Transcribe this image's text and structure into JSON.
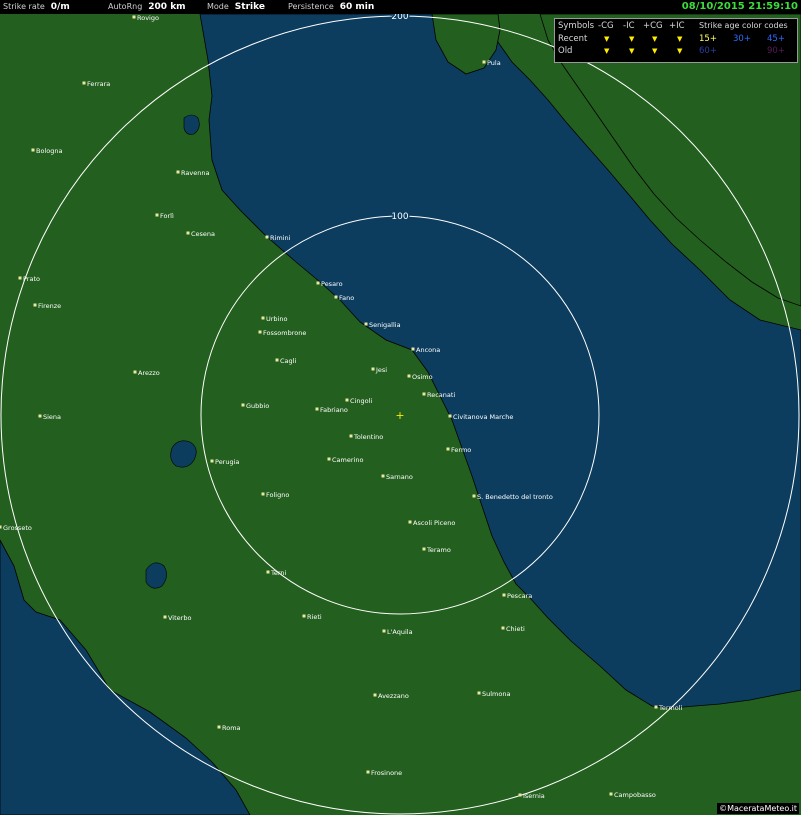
{
  "topbar": {
    "strike_rate_label": "Strike rate",
    "strike_rate_value": "0/m",
    "autorng_label": "AutoRng",
    "autorng_value": "200 km",
    "mode_label": "Mode",
    "mode_value": "Strike",
    "persistence_label": "Persistence",
    "persistence_value": "60 min",
    "datetime": "08/10/2015 21:59:10"
  },
  "legend": {
    "symbols_label": "Symbols",
    "col_cg_neg": "-CG",
    "col_ic_neg": "-IC",
    "col_cg_pos": "+CG",
    "col_ic_pos": "+IC",
    "age_title": "Strike age color codes",
    "recent_label": "Recent",
    "old_label": "Old",
    "symbol_glyph": "▼",
    "age_codes": [
      "15+",
      "30+",
      "45+",
      "60+",
      "90+"
    ],
    "age_colors": [
      "#ffff66",
      "#2a6cff",
      "#2a6cff",
      "#2a3fa0",
      "#5a1a5a"
    ]
  },
  "rings": [
    {
      "label": "100"
    },
    {
      "label": "200"
    }
  ],
  "cities": [
    {
      "name": "Rovigo"
    },
    {
      "name": "Pula"
    },
    {
      "name": "Ferrara"
    },
    {
      "name": "Bologna"
    },
    {
      "name": "Ravenna"
    },
    {
      "name": "Forlì"
    },
    {
      "name": "Cesena"
    },
    {
      "name": "Rimini"
    },
    {
      "name": "Prato"
    },
    {
      "name": "Firenze"
    },
    {
      "name": "Pesaro"
    },
    {
      "name": "Fano"
    },
    {
      "name": "Urbino"
    },
    {
      "name": "Fossombrone"
    },
    {
      "name": "Senigallia"
    },
    {
      "name": "Ancona"
    },
    {
      "name": "Cagli"
    },
    {
      "name": "Jesi"
    },
    {
      "name": "Osimo"
    },
    {
      "name": "Arezzo"
    },
    {
      "name": "Recanati"
    },
    {
      "name": "Cingoli"
    },
    {
      "name": "Fabriano"
    },
    {
      "name": "Gubbio"
    },
    {
      "name": "Siena"
    },
    {
      "name": "Civitanova Marche"
    },
    {
      "name": "Tolentino"
    },
    {
      "name": "Fermo"
    },
    {
      "name": "Camerino"
    },
    {
      "name": "Perugia"
    },
    {
      "name": "Sarnano"
    },
    {
      "name": "Foligno"
    },
    {
      "name": "S. Benedetto del tronto"
    },
    {
      "name": "Grosseto"
    },
    {
      "name": "Ascoli Piceno"
    },
    {
      "name": "Teramo"
    },
    {
      "name": "Terni"
    },
    {
      "name": "Pescara"
    },
    {
      "name": "Viterbo"
    },
    {
      "name": "Rieti"
    },
    {
      "name": "Chieti"
    },
    {
      "name": "L'Aquila"
    },
    {
      "name": "Sulmona"
    },
    {
      "name": "Avezzano"
    },
    {
      "name": "Termoli"
    },
    {
      "name": "Roma"
    },
    {
      "name": "Frosinone"
    },
    {
      "name": "Isernia"
    },
    {
      "name": "Campobasso"
    }
  ],
  "colors": {
    "land": "#235f1e",
    "sea": "#0c3d5e",
    "ring": "#ffffff",
    "center_marker": "#ffee00"
  },
  "credit": "©MacerataMeteo.it"
}
